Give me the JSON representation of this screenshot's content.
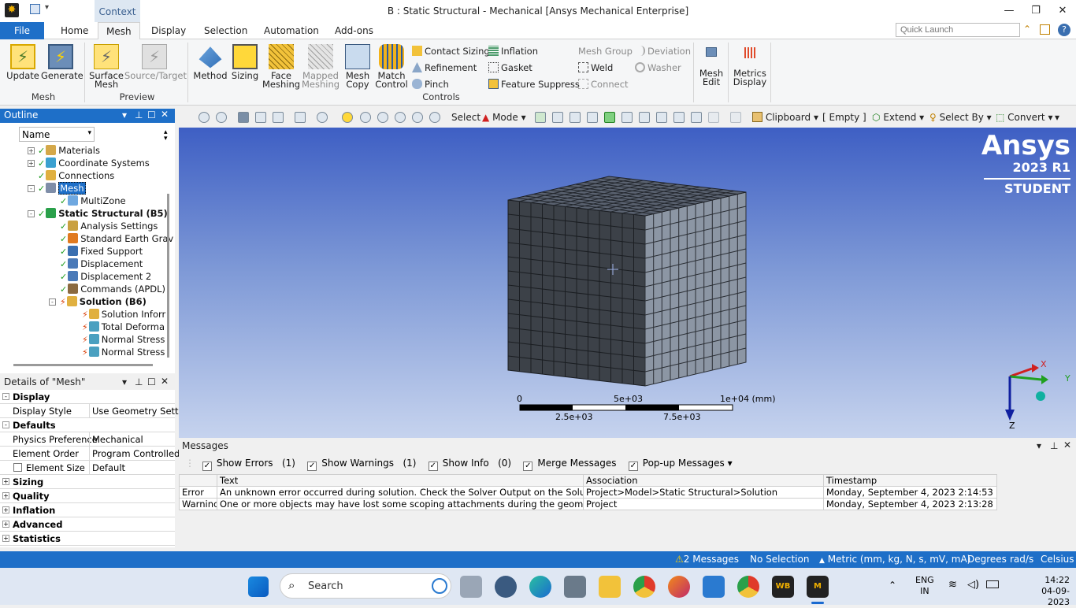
{
  "title": "B : Static Structural - Mechanical [Ansys Mechanical Enterprise]",
  "context_tab": "Context",
  "tabs": [
    "File",
    "Home",
    "Mesh",
    "Display",
    "Selection",
    "Automation",
    "Add-ons"
  ],
  "quick_launch_placeholder": "Quick Launch",
  "ribbon": {
    "update": "Update",
    "generate": "Generate",
    "mesh_group": "Mesh",
    "surface_mesh": "Surface Mesh",
    "source_target": "Source/Target",
    "preview_group": "Preview",
    "method": "Method",
    "sizing": "Sizing",
    "face_meshing": "Face Meshing",
    "mapped_meshing": "Mapped Meshing",
    "mesh_copy": "Mesh Copy",
    "match_control": "Match Control",
    "contact_sizing": "Contact Sizing",
    "refinement": "Refinement",
    "pinch": "Pinch",
    "inflation": "Inflation",
    "gasket": "Gasket",
    "feature_suppress": "Feature Suppress",
    "mesh_group_btn": "Mesh Group",
    "weld": "Weld",
    "connect": "Connect",
    "deviation": "Deviation",
    "washer": "Washer",
    "controls_group": "Controls",
    "mesh_edit": "Mesh Edit",
    "metrics_display": "Metrics Display"
  },
  "toolbar": {
    "select": "Select",
    "mode": "Mode",
    "clipboard": "Clipboard",
    "empty": "[ Empty ]",
    "extend": "Extend",
    "select_by": "Select By",
    "convert": "Convert"
  },
  "outline": {
    "title": "Outline",
    "filter": "Name",
    "items": [
      {
        "label": "Materials",
        "indent": 1,
        "expander": "+"
      },
      {
        "label": "Coordinate Systems",
        "indent": 1,
        "expander": "+"
      },
      {
        "label": "Connections",
        "indent": 1,
        "expander": ""
      },
      {
        "label": "Mesh",
        "indent": 1,
        "expander": "-",
        "selected": true
      },
      {
        "label": "MultiZone",
        "indent": 2,
        "expander": ""
      },
      {
        "label": "Static Structural (B5)",
        "indent": 1,
        "expander": "-",
        "bold": true
      },
      {
        "label": "Analysis Settings",
        "indent": 2,
        "expander": ""
      },
      {
        "label": "Standard Earth Grav",
        "indent": 2,
        "expander": ""
      },
      {
        "label": "Fixed Support",
        "indent": 2,
        "expander": ""
      },
      {
        "label": "Displacement",
        "indent": 2,
        "expander": ""
      },
      {
        "label": "Displacement 2",
        "indent": 2,
        "expander": ""
      },
      {
        "label": "Commands (APDL)",
        "indent": 2,
        "expander": ""
      },
      {
        "label": "Solution (B6)",
        "indent": 2,
        "expander": "-",
        "bold": true,
        "bolt": true
      },
      {
        "label": "Solution Inforr",
        "indent": 3,
        "expander": "",
        "bolt": true
      },
      {
        "label": "Total Deforma",
        "indent": 3,
        "expander": "",
        "bolt": true
      },
      {
        "label": "Normal Stress",
        "indent": 3,
        "expander": "",
        "bolt": true
      },
      {
        "label": "Normal Stress",
        "indent": 3,
        "expander": "",
        "bolt": true
      }
    ]
  },
  "details": {
    "title": "Details of \"Mesh\"",
    "display_cat": "Display",
    "display_style_k": "Display Style",
    "display_style_v": "Use Geometry Sett...",
    "defaults_cat": "Defaults",
    "physics_k": "Physics Preference",
    "physics_v": "Mechanical",
    "order_k": "Element Order",
    "order_v": "Program Controlled",
    "size_k": "Element Size",
    "size_v": "Default",
    "sizing_cat": "Sizing",
    "quality_cat": "Quality",
    "inflation_cat": "Inflation",
    "advanced_cat": "Advanced",
    "statistics_cat": "Statistics"
  },
  "viewport": {
    "brand": "Ansys",
    "version": "2023 R1",
    "edition": "STUDENT",
    "scale_0": "0",
    "scale_5e3": "5e+03",
    "scale_1e4": "1e+04 (mm)",
    "scale_25e3": "2.5e+03",
    "scale_75e3": "7.5e+03",
    "axis_x": "X",
    "axis_y": "Y",
    "axis_z": "Z"
  },
  "messages": {
    "title": "Messages",
    "show_errors": "Show Errors",
    "errors_count": "(1)",
    "show_warnings": "Show Warnings",
    "warnings_count": "(1)",
    "show_info": "Show Info",
    "info_count": "(0)",
    "merge": "Merge Messages",
    "popup": "Pop-up Messages",
    "col_text": "Text",
    "col_assoc": "Association",
    "col_time": "Timestamp",
    "rows": [
      {
        "type": "Error",
        "text": "An unknown error occurred during solution.  Check the Solver Output on the Solution In",
        "assoc": "Project>Model>Static Structural>Solution",
        "time": "Monday, September 4, 2023 2:14:53 PM"
      },
      {
        "type": "Warninc",
        "text": "One or more objects may have lost some scoping attachments during the geometry updat",
        "assoc": "Project",
        "time": "Monday, September 4, 2023 2:13:28 PM"
      }
    ]
  },
  "status": {
    "messages": "2 Messages",
    "selection": "No Selection",
    "units": "Metric (mm, kg, N, s, mV, mA)",
    "degrees": "Degrees",
    "rad": "rad/s",
    "celsius": "Celsius"
  },
  "taskbar": {
    "search": "Search",
    "lang1": "ENG",
    "lang2": "IN",
    "time": "14:22",
    "date": "04-09-2023"
  }
}
